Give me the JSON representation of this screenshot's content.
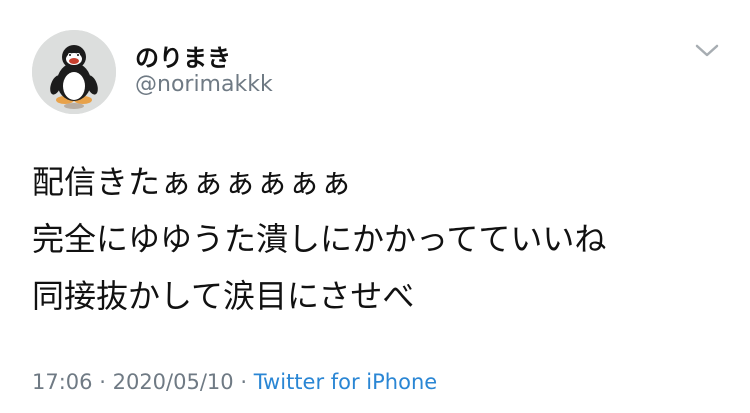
{
  "tweet": {
    "author": {
      "display_name": "のりまき",
      "handle": "@norimakkk",
      "avatar_icon": "penguin-avatar-icon"
    },
    "menu_icon": "chevron-down-icon",
    "body_lines": [
      "配信きたぁぁぁぁぁぁ",
      "完全にゆゆうた潰しにかかってていいね",
      "同接抜かして涙目にさせべ"
    ],
    "time": "17:06",
    "separator": "·",
    "date": "2020/05/10",
    "source": "Twitter for iPhone",
    "colors": {
      "text": "#111111",
      "secondary": "#6f7a84",
      "link": "#2a86d4",
      "chevron": "#a7adb2"
    }
  }
}
